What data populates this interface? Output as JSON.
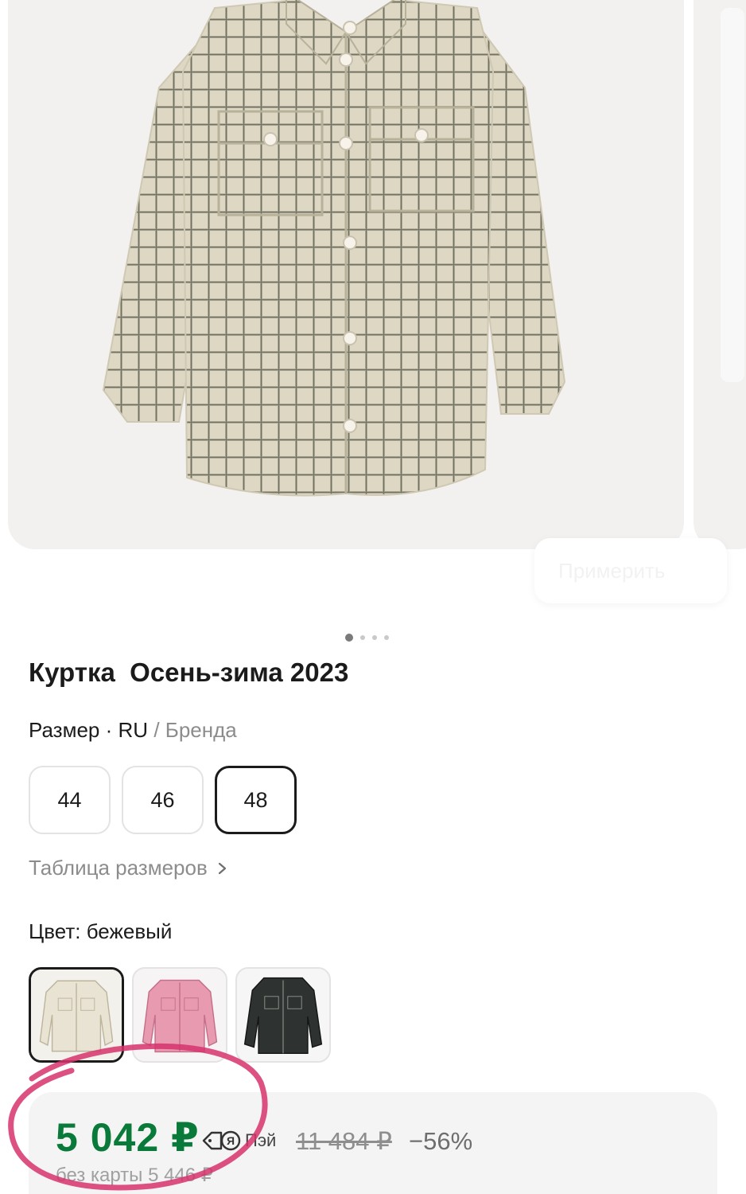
{
  "gallery": {
    "photo_alt": "",
    "dots_count": 4,
    "active_dot": 0,
    "ghost_chip_text": "Примерить"
  },
  "product": {
    "title": "Куртка  Осень-зима 2023"
  },
  "size": {
    "label": "Размер",
    "separator": "·",
    "system_ru": "RU",
    "slash": "/",
    "system_brand": "Бренда",
    "options": [
      "44",
      "46",
      "48"
    ],
    "selected": "48",
    "table_link": "Таблица размеров"
  },
  "color": {
    "label": "Цвет: бежевый",
    "options": [
      {
        "name": "бежевый",
        "fill": "#e9e3d4",
        "selected": true
      },
      {
        "name": "розовый",
        "fill": "#e79ab0",
        "selected": false
      },
      {
        "name": "черный",
        "fill": "#2e3230",
        "selected": false
      }
    ]
  },
  "price": {
    "current": "5 042 ₽",
    "pay_label": "Пэй",
    "old": "11 484 ₽",
    "discount": "−56%",
    "without_card": "без карты 5 446 ₽"
  },
  "colors": {
    "price_green": "#0a7a3a",
    "highlight_pink": "#d6336c",
    "selected_border": "#1b1b1b"
  },
  "icons": {
    "pay": "yandex-pay-icon",
    "chevron": "chevron-right-icon"
  }
}
